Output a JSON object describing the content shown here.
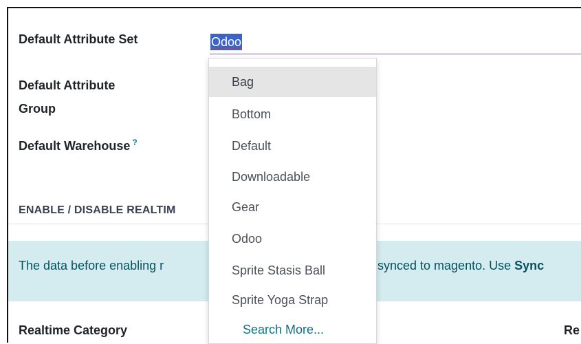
{
  "form": {
    "default_attribute_set": {
      "label": "Default Attribute Set",
      "value": "Odoo"
    },
    "default_attribute_group": {
      "label_line1": "Default Attribute",
      "label_line2": "Group"
    },
    "default_warehouse": {
      "label": "Default Warehouse",
      "help_mark": "?"
    }
  },
  "section": {
    "title": "ENABLE / DISABLE REALTIM"
  },
  "alert": {
    "text_left": "The data before enabling r",
    "text_right_prefix": "synced to magento. Use ",
    "text_right_bold": "Sync"
  },
  "bottom": {
    "left_label": "Realtime Category",
    "right_label": "Re"
  },
  "dropdown": {
    "items": [
      "Bag",
      "Bottom",
      "Default",
      "Downloadable",
      "Gear",
      "Odoo",
      "Sprite Stasis Ball",
      "Sprite Yoga Strap"
    ],
    "active_item": "Bag",
    "search_more": "Search More..."
  }
}
